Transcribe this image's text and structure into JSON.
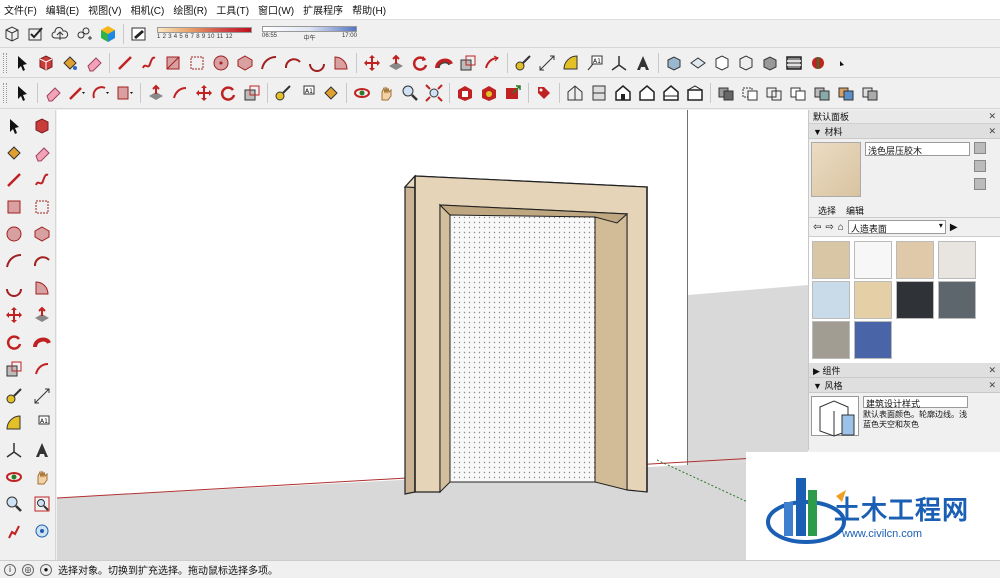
{
  "menu": [
    "文件(F)",
    "编辑(E)",
    "视图(V)",
    "相机(C)",
    "绘图(R)",
    "工具(T)",
    "窗口(W)",
    "扩展程序",
    "帮助(H)"
  ],
  "shadow_scale": {
    "numbers": "1 2 3 4 5 6 7 8 9 10 11 12"
  },
  "time_scale": {
    "start": "06:55",
    "mid": "中午",
    "end": "17:00"
  },
  "panel": {
    "title": "默认面板",
    "materials": {
      "section": "材料",
      "current": "浅色层压胶木",
      "tab_select": "选择",
      "tab_edit": "编辑",
      "library": "人造表面",
      "swatches": [
        "#d9c6a5",
        "#f7f7f7",
        "#dfc9a8",
        "#e8e4df",
        "#c9dbe9",
        "#e4cfa7",
        "#2f3236",
        "#5d666d",
        "#a19d92",
        "#4a64a8"
      ]
    },
    "components": {
      "section": "组件"
    },
    "styles": {
      "section": "风格",
      "current": "建筑设计样式",
      "description": "默认表面颜色。轮廓边线。浅蓝色天空和灰色"
    }
  },
  "status": {
    "text": "选择对象。切换到扩充选择。拖动鼠标选择多项。"
  },
  "watermark": {
    "name": "土木工程网",
    "url": "www.civilcn.com"
  }
}
